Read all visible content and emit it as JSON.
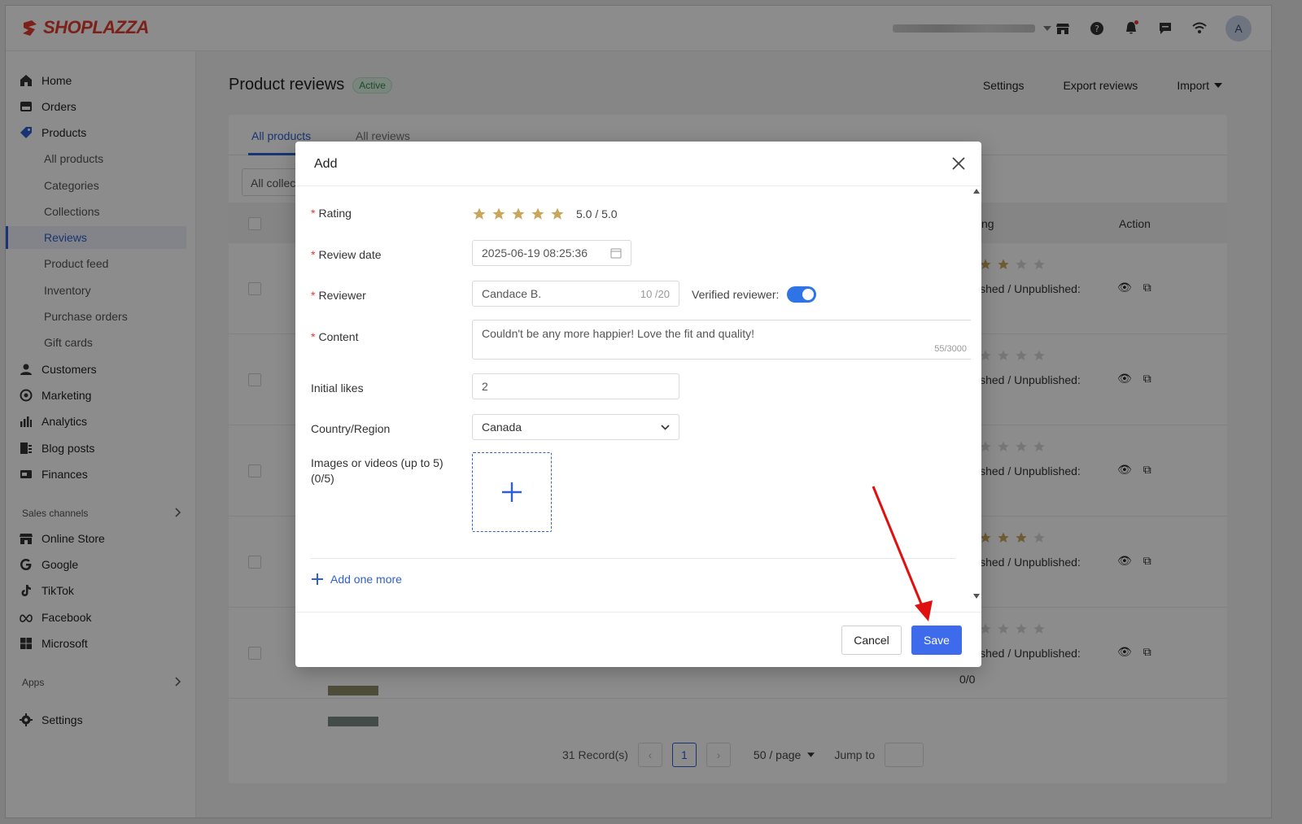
{
  "brand": {
    "name": "SHOPLAZZA",
    "color": "#e23b2e"
  },
  "topbar": {
    "store_selector_icon": "chevron-down-icon",
    "avatar_letter": "A"
  },
  "sidebar": {
    "items": [
      {
        "label": "Home",
        "icon": "home-icon"
      },
      {
        "label": "Orders",
        "icon": "orders-icon"
      },
      {
        "label": "Products",
        "icon": "tag-icon"
      },
      {
        "label": "All products"
      },
      {
        "label": "Categories"
      },
      {
        "label": "Collections"
      },
      {
        "label": "Reviews"
      },
      {
        "label": "Product feed"
      },
      {
        "label": "Inventory"
      },
      {
        "label": "Purchase orders"
      },
      {
        "label": "Gift cards"
      },
      {
        "label": "Customers",
        "icon": "person-icon"
      },
      {
        "label": "Marketing",
        "icon": "marketing-icon"
      },
      {
        "label": "Analytics",
        "icon": "bar-chart-icon"
      },
      {
        "label": "Blog posts",
        "icon": "blog-icon"
      },
      {
        "label": "Finances",
        "icon": "finances-icon"
      }
    ],
    "sales_channels_label": "Sales channels",
    "channels": [
      {
        "label": "Online Store"
      },
      {
        "label": "Google"
      },
      {
        "label": "TikTok"
      },
      {
        "label": "Facebook"
      },
      {
        "label": "Microsoft"
      }
    ],
    "apps_label": "Apps",
    "settings_label": "Settings"
  },
  "page": {
    "title": "Product reviews",
    "status_badge": "Active",
    "actions": {
      "settings": "Settings",
      "export": "Export reviews",
      "import": "Import"
    },
    "tabs": [
      "All products",
      "All reviews"
    ],
    "filter_placeholder": "All collections",
    "table": {
      "rating_header": "ting",
      "action_header": "Action",
      "status_text": "ished / Unpublished:",
      "last_row_likes": "0/0"
    },
    "pagination": {
      "records": "31 Record(s)",
      "current_page": "1",
      "page_size": "50 / page",
      "jump_label": "Jump to"
    }
  },
  "modal": {
    "title": "Add",
    "fields": {
      "rating": {
        "label": "Rating",
        "value": "5.0 / 5.0",
        "stars": 5
      },
      "review_date": {
        "label": "Review date",
        "value": "2025-06-19 08:25:36"
      },
      "reviewer": {
        "label": "Reviewer",
        "value": "Candace B.",
        "counter": "10 /20"
      },
      "verified": {
        "label": "Verified reviewer:",
        "on": true
      },
      "content": {
        "label": "Content",
        "value": "Couldn't be any more happier! Love the fit and quality!",
        "counter": "55/3000"
      },
      "initial_likes": {
        "label": "Initial likes",
        "value": "2"
      },
      "country": {
        "label": "Country/Region",
        "value": "Canada"
      },
      "media": {
        "label_line1": "Images or videos (up to 5)",
        "label_line2": "(0/5)"
      }
    },
    "add_more": "Add one more",
    "cancel": "Cancel",
    "save": "Save"
  },
  "colors": {
    "primary": "#3d6bec",
    "star": "#c9a65a",
    "star_empty": "#d7d7d7",
    "annotation_arrow": "#e01010"
  }
}
